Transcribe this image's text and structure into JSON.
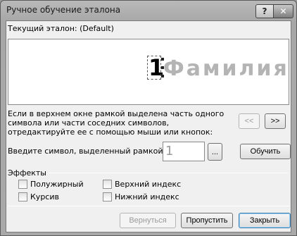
{
  "window": {
    "title": "Ручное обучение эталона",
    "help_label": "?",
    "close_label": "✕"
  },
  "etalon": {
    "label": "Текущий эталон:  (Default)"
  },
  "preview": {
    "selected_char": "1",
    "text": "Фамилия"
  },
  "instructions": "Если в верхнем окне рамкой выделена часть одного символа или части соседних символов, отредактируйте ее с помощью мыши или кнопок:",
  "nav": {
    "prev_label": "<<",
    "next_label": ">>"
  },
  "symbol": {
    "label": "Введите символ, выделенный рамкой:",
    "value": "1",
    "browse_label": "...",
    "train_label": "Обучить"
  },
  "effects": {
    "title": "Эффекты",
    "bold": "Полужирный",
    "italic": "Курсив",
    "superscript": "Верхний индекс",
    "subscript": "Нижний индекс"
  },
  "footer": {
    "back_label": "Вернуться",
    "skip_label": "Пропустить",
    "close_label": "Закрыть"
  }
}
